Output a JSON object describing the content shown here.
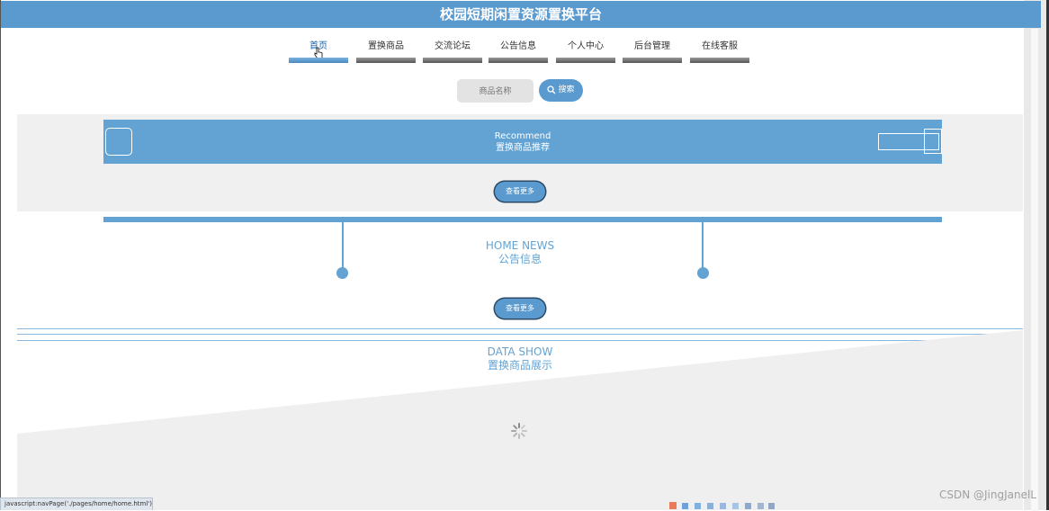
{
  "app": {
    "title": "校园短期闲置资源置换平台"
  },
  "nav": {
    "items": [
      {
        "label": "首页",
        "active": true
      },
      {
        "label": "置换商品",
        "active": false
      },
      {
        "label": "交流论坛",
        "active": false
      },
      {
        "label": "公告信息",
        "active": false
      },
      {
        "label": "个人中心",
        "active": false
      },
      {
        "label": "后台管理",
        "active": false
      },
      {
        "label": "在线客服",
        "active": false
      }
    ]
  },
  "search": {
    "placeholder": "商品名称",
    "value": "",
    "button_label": "搜索",
    "icon": "search-icon"
  },
  "recommend": {
    "title_en": "Recommend",
    "title_cn": "置换商品推荐",
    "more_label": "查看更多"
  },
  "news": {
    "title_en": "HOME NEWS",
    "title_cn": "公告信息",
    "more_label": "查看更多"
  },
  "data_show": {
    "title_en": "DATA SHOW",
    "title_cn": "置换商品展示",
    "loading_icon": "spinner-icon"
  },
  "statusbar": {
    "text": "javascript:navPage('./pages/home/home.html')"
  },
  "watermark": {
    "text": "CSDN @JingJanelL"
  },
  "colors": {
    "accent": "#5a9acf",
    "banner": "#62a3d4",
    "panel": "#f0f0f0"
  }
}
